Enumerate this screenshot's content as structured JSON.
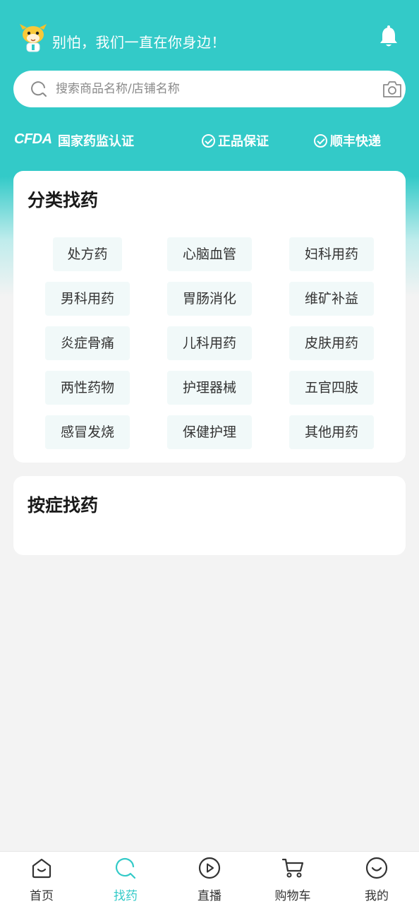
{
  "header": {
    "greeting": "别怕，我们一直在你身边！"
  },
  "search": {
    "placeholder": "搜索商品名称/店铺名称"
  },
  "trust": {
    "cfda_logo": "CFDA",
    "cfda_text": "国家药监认证",
    "badges": [
      "正品保证",
      "顺丰快递"
    ]
  },
  "category_section": {
    "title": "分类找药",
    "items": [
      "处方药",
      "心脑血管",
      "妇科用药",
      "男科用药",
      "胃肠消化",
      "维矿补益",
      "炎症骨痛",
      "儿科用药",
      "皮肤用药",
      "两性药物",
      "护理器械",
      "五官四肢",
      "感冒发烧",
      "保健护理",
      "其他用药"
    ]
  },
  "symptom_section": {
    "title": "按症找药"
  },
  "tabbar": {
    "tabs": [
      {
        "label": "首页",
        "icon": "home-icon"
      },
      {
        "label": "找药",
        "icon": "find-medicine-icon",
        "active": true
      },
      {
        "label": "直播",
        "icon": "live-play-icon"
      },
      {
        "label": "购物车",
        "icon": "cart-icon"
      },
      {
        "label": "我的",
        "icon": "profile-smile-icon"
      }
    ]
  },
  "colors": {
    "accent": "#33cac8",
    "chip_bg": "#f1f9f9",
    "page_bg": "#f3f3f3"
  }
}
